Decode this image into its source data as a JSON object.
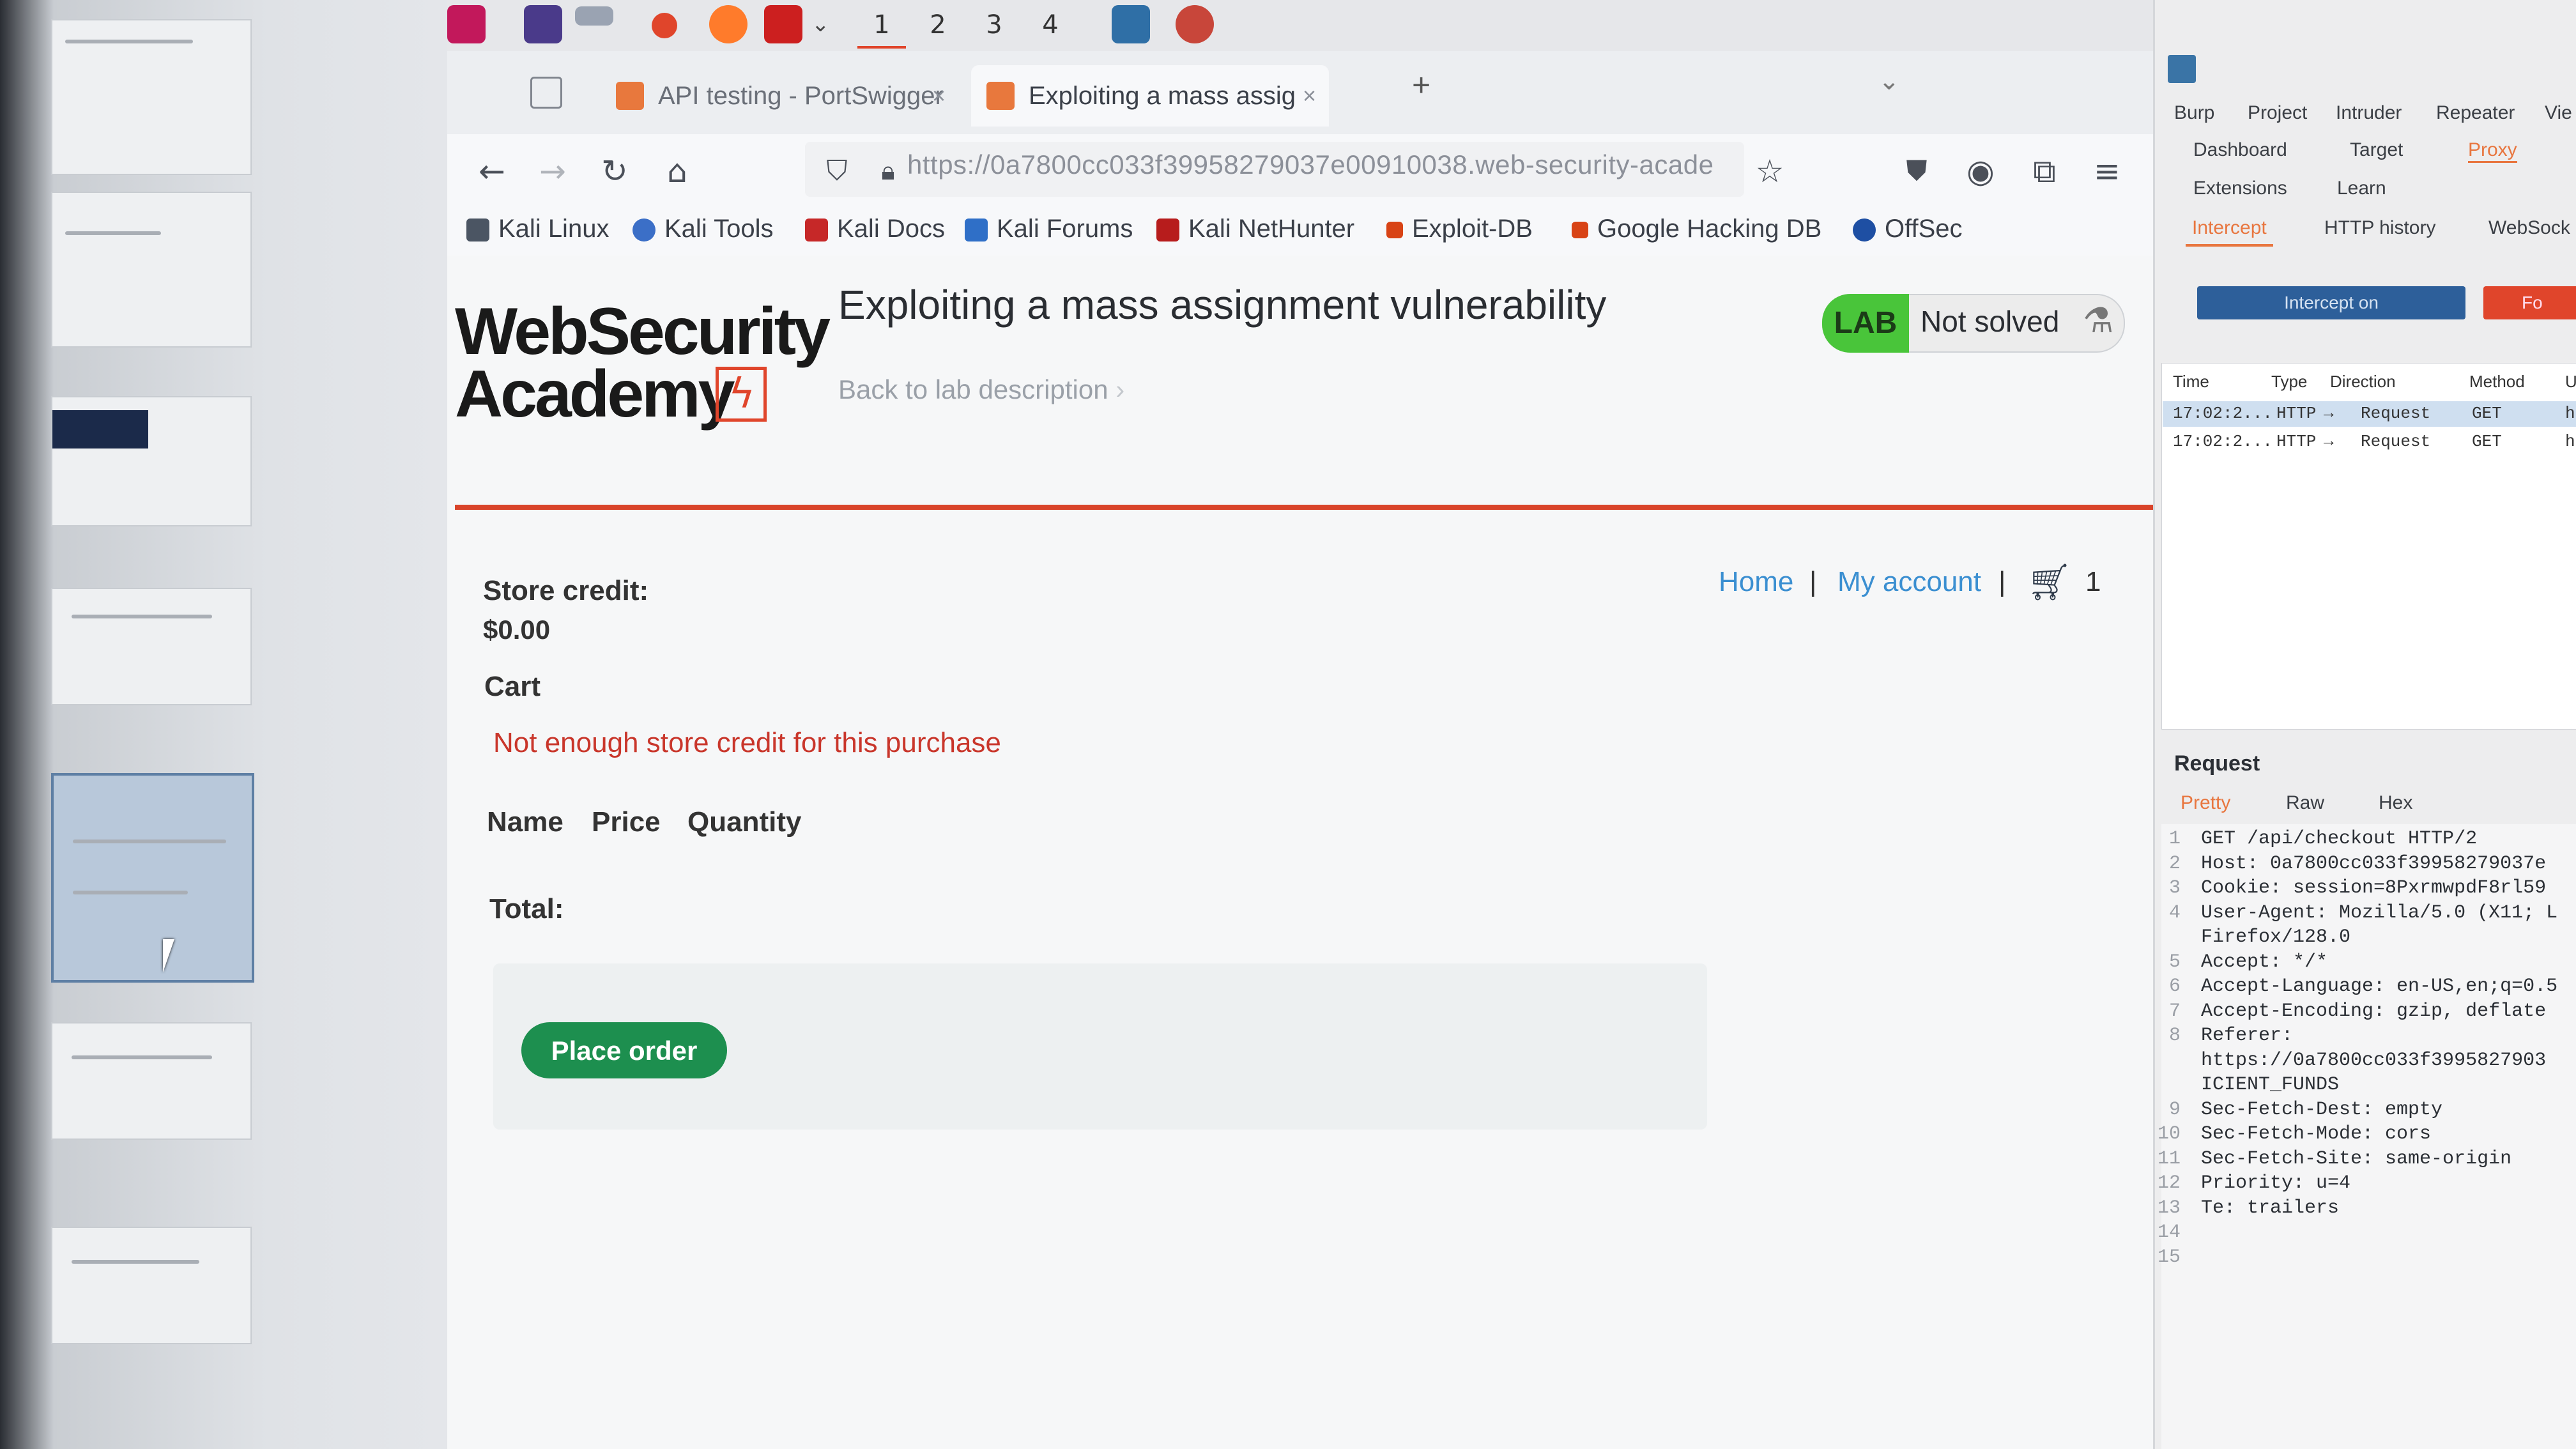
{
  "taskbar": {
    "workspaces": [
      "1",
      "2",
      "3",
      "4"
    ]
  },
  "browser": {
    "tabs": [
      {
        "label": "API testing - PortSwigger"
      },
      {
        "label": "Exploiting a mass assig"
      }
    ],
    "new_tab": "+",
    "url": "https://0a7800cc033f39958279037e00910038.web-security-acade",
    "bookmarks": [
      "Kali Linux",
      "Kali Tools",
      "Kali Docs",
      "Kali Forums",
      "Kali NetHunter",
      "Exploit-DB",
      "Google Hacking DB",
      "OffSec"
    ]
  },
  "page": {
    "logo_line1": "WebSecurity",
    "logo_line2": "Academy",
    "title": "Exploiting a mass assignment vulnerability",
    "back_link": "Back to lab description",
    "lab_tag": "LAB",
    "lab_status": "Not solved",
    "store_credit_label": "Store credit:",
    "store_credit_value": "$0.00",
    "nav_home": "Home",
    "nav_separator": "|",
    "nav_account": "My account",
    "cart_count": "1",
    "cart_title": "Cart",
    "error": "Not enough store credit for this purchase",
    "columns": [
      "Name",
      "Price",
      "Quantity"
    ],
    "total_label": "Total:",
    "place_order": "Place order"
  },
  "burp": {
    "menu": [
      "Burp",
      "Project",
      "Intruder",
      "Repeater",
      "Vie"
    ],
    "tabs_row1": [
      "Dashboard",
      "Target",
      "Proxy"
    ],
    "tabs_row2": [
      "Extensions",
      "Learn"
    ],
    "proxy_tabs": [
      "Intercept",
      "HTTP history",
      "WebSock"
    ],
    "intercept_label": "Intercept on",
    "forward_label": "Fo",
    "history_headers": [
      "Time",
      "Type",
      "Direction",
      "Method",
      "U"
    ],
    "history_rows": [
      {
        "time": "17:02:2...",
        "type": "HTTP",
        "direction": "Request",
        "method": "GET",
        "u": "ht"
      },
      {
        "time": "17:02:2...",
        "type": "HTTP",
        "direction": "Request",
        "method": "GET",
        "u": "ht"
      }
    ],
    "request_title": "Request",
    "request_tabs": [
      "Pretty",
      "Raw",
      "Hex"
    ],
    "request_lines": [
      {
        "n": "1",
        "text": "GET /api/checkout HTTP/2"
      },
      {
        "n": "2",
        "text": "Host: 0a7800cc033f39958279037e"
      },
      {
        "n": "3",
        "text": "Cookie: session=8PxrmwpdF8rl59"
      },
      {
        "n": "4",
        "text": "User-Agent: Mozilla/5.0 (X11; L"
      },
      {
        "n": "",
        "text": "Firefox/128.0"
      },
      {
        "n": "5",
        "text": "Accept: */*"
      },
      {
        "n": "6",
        "text": "Accept-Language: en-US,en;q=0.5"
      },
      {
        "n": "7",
        "text": "Accept-Encoding: gzip, deflate"
      },
      {
        "n": "8",
        "text": "Referer:"
      },
      {
        "n": "",
        "text": "https://0a7800cc033f3995827903"
      },
      {
        "n": "",
        "text": "ICIENT_FUNDS"
      },
      {
        "n": "9",
        "text": "Sec-Fetch-Dest: empty"
      },
      {
        "n": "10",
        "text": "Sec-Fetch-Mode: cors"
      },
      {
        "n": "11",
        "text": "Sec-Fetch-Site: same-origin"
      },
      {
        "n": "12",
        "text": "Priority: u=4"
      },
      {
        "n": "13",
        "text": "Te: trailers"
      },
      {
        "n": "14",
        "text": ""
      },
      {
        "n": "15",
        "text": ""
      }
    ]
  },
  "colors": {
    "accent_red": "#d9442a",
    "lab_green": "#49c53a",
    "button_green": "#1d8f4f",
    "link_blue": "#3b8fd1",
    "error_red": "#c9362b"
  }
}
